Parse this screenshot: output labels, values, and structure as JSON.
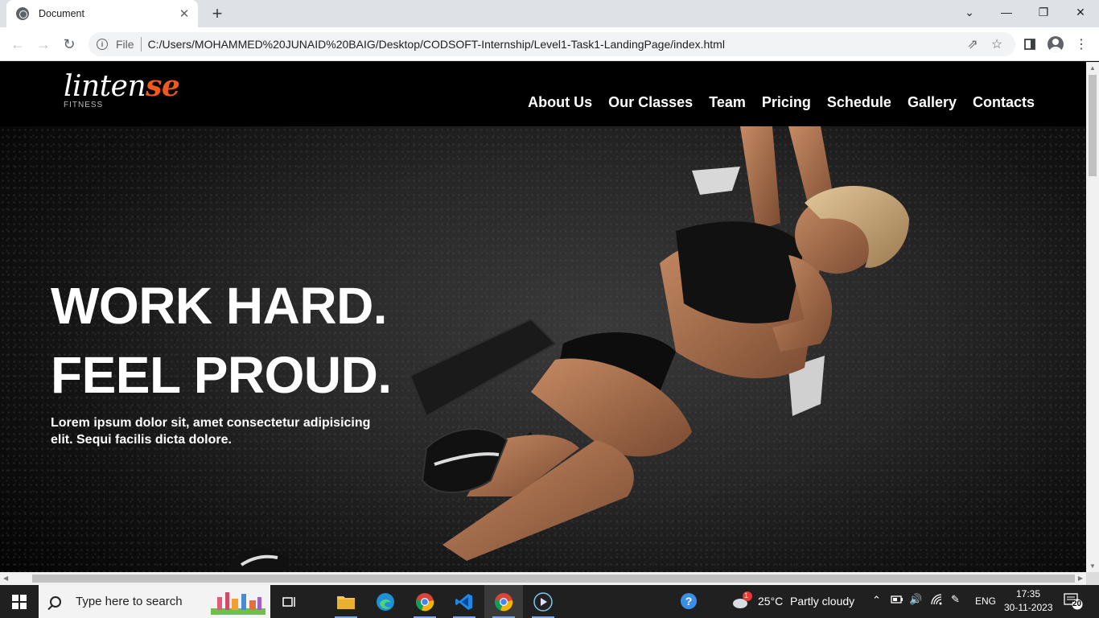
{
  "browser": {
    "tab_title": "Document",
    "tab_close": "✕",
    "new_tab": "+",
    "controls": {
      "minimize": "—",
      "restore": "❐",
      "close": "✕",
      "tab_search": "⌄"
    },
    "file_label": "File",
    "url": "C:/Users/MOHAMMED%20JUNAID%20BAIG/Desktop/CODSOFT-Internship/Level1-Task1-LandingPage/index.html"
  },
  "site": {
    "logo": {
      "main": "lintense",
      "main_plain": "linten",
      "main_accent": "se",
      "sub": "FITNESS"
    },
    "nav": [
      "About Us",
      "Our Classes",
      "Team",
      "Pricing",
      "Schedule",
      "Gallery",
      "Contacts"
    ],
    "hero": {
      "headline_line1": "WORK HARD.",
      "headline_line2": "FEEL PROUD.",
      "tagline": "Lorem ipsum dolor sit, amet consectetur adipisicing elit. Sequi facilis dicta dolore."
    },
    "accent_color": "#f25a1d"
  },
  "taskbar": {
    "search_placeholder": "Type here to search",
    "weather_badge": "1",
    "weather_temp": "25°C",
    "weather_text": "Partly cloudy",
    "language": "ENG",
    "time": "17:35",
    "date": "30-11-2023",
    "notifications": "20"
  }
}
